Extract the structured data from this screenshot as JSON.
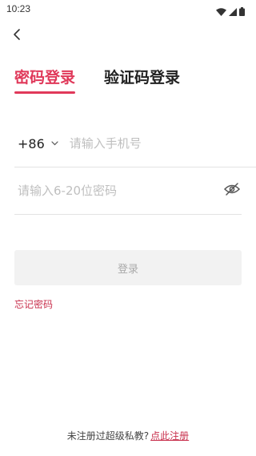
{
  "status_bar": {
    "time": "10:23",
    "icons": [
      "wifi-icon",
      "signal-icon",
      "battery-icon"
    ]
  },
  "nav": {
    "back_icon": "chevron-left-icon"
  },
  "tabs": [
    {
      "label": "密码登录",
      "active": true
    },
    {
      "label": "验证码登录",
      "active": false
    }
  ],
  "phone": {
    "country_code": "+86",
    "placeholder": "请输入手机号",
    "value": ""
  },
  "password": {
    "placeholder": "请输入6-20位密码",
    "value": "",
    "visibility_icon": "eye-off-icon"
  },
  "login_button": {
    "label": "登录",
    "enabled": false
  },
  "forgot_password": "忘记密码",
  "footer": {
    "text": "未注册过超级私教?",
    "link": "点此注册"
  },
  "colors": {
    "accent": "#e0395a",
    "link": "#c8304d",
    "button_bg": "#f2f2f2",
    "button_text": "#a9a9a9",
    "placeholder": "#bfbfbf",
    "divider": "#e3e3e3"
  }
}
